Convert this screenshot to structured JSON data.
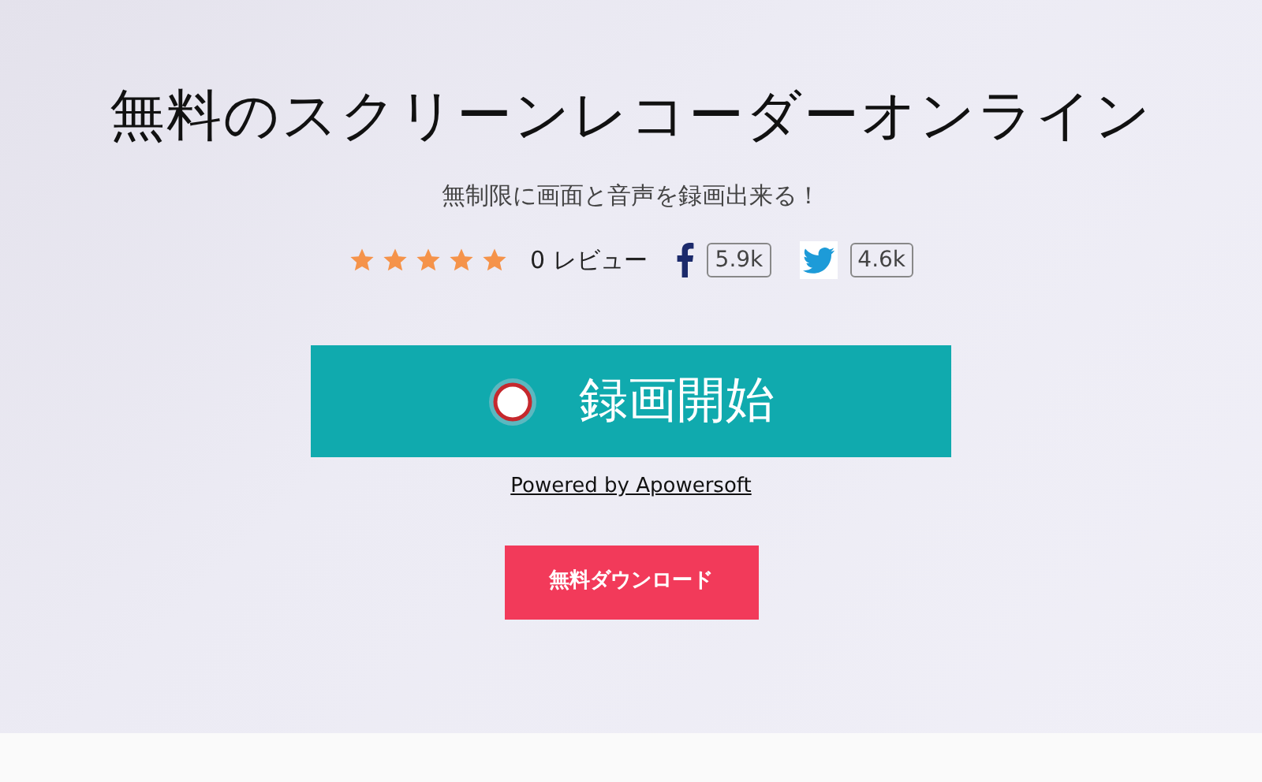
{
  "title": "無料のスクリーンレコーダーオンライン",
  "subtitle": "無制限に画面と音声を録画出来る！",
  "rating": {
    "stars": 5,
    "reviews": "0 レビュー"
  },
  "shares": [
    {
      "kind": "facebook",
      "count": "5.9k"
    },
    {
      "kind": "twitter",
      "count": "4.6k"
    }
  ],
  "record_button": "録画開始",
  "powered_by": "Powered by Apowersoft",
  "download_button": "無料ダウンロード"
}
